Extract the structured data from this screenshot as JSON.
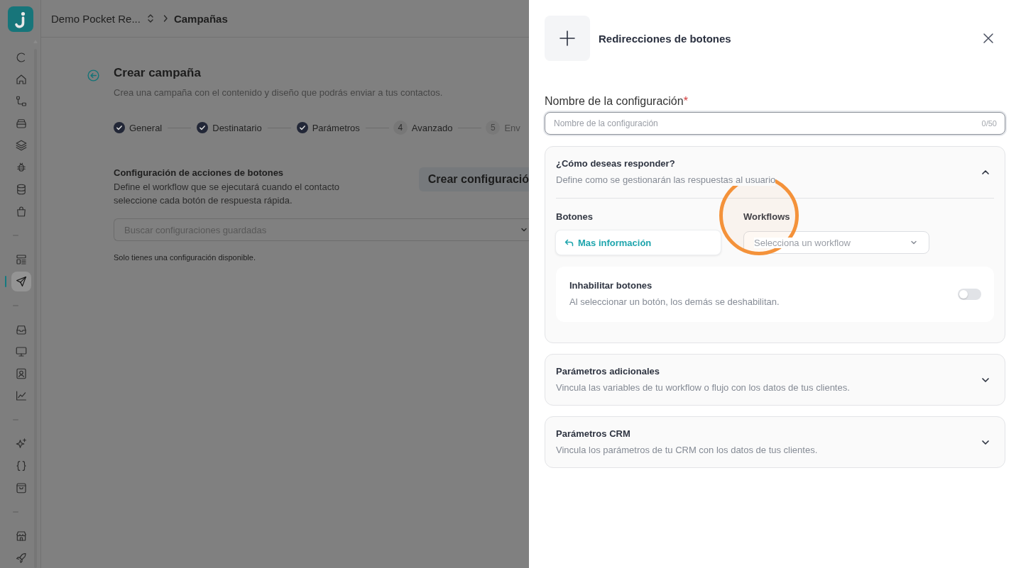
{
  "sidebar": {
    "groups": [
      {
        "items": [
          {
            "selected": false
          },
          {
            "selected": false
          },
          {
            "selected": false
          },
          {
            "selected": false
          },
          {
            "selected": false
          },
          {
            "selected": false
          },
          {
            "selected": false
          },
          {
            "selected": false
          }
        ]
      },
      {
        "items": [
          {
            "selected": false
          },
          {
            "selected": true
          }
        ]
      },
      {
        "items": [
          {
            "selected": false
          },
          {
            "selected": false
          },
          {
            "selected": false
          },
          {
            "selected": false
          }
        ]
      },
      {
        "items": [
          {
            "selected": false
          },
          {
            "selected": false
          },
          {
            "selected": false
          }
        ]
      },
      {
        "items": [
          {
            "selected": false
          },
          {
            "selected": false
          }
        ]
      }
    ]
  },
  "top_bar": {
    "workspace": "Demo Pocket Re...",
    "page": "Campañas"
  },
  "page": {
    "title": "Crear campaña",
    "subtitle": "Crea una campaña con el contenido y diseño que podrás enviar a tus contactos.",
    "steps": [
      {
        "label": "General",
        "completed": true,
        "disabled": false
      },
      {
        "label": "Destinatario",
        "completed": true,
        "disabled": false
      },
      {
        "label": "Parámetros",
        "completed": true,
        "disabled": false
      },
      {
        "number": "4",
        "label": "Avanzado",
        "completed": false,
        "disabled": false
      },
      {
        "number": "5",
        "label": "Env",
        "completed": false,
        "disabled": true
      }
    ],
    "section": {
      "title": "Configuración de acciones de botones",
      "description": "Define el workflow que se ejecutará cuando el contacto seleccione cada botón de respuesta rápida.",
      "create_button": "Crear configuració",
      "search": {
        "placeholder": "Buscar configuraciones guardadas"
      },
      "note": "Solo tienes una configuración disponible."
    }
  },
  "panel": {
    "title": "Redirecciones de botones",
    "field": {
      "label": "Nombre de la configuración",
      "required_mark": "*",
      "placeholder": "Nombre de la configuración",
      "counter": "0/50"
    },
    "sections": [
      {
        "title": "¿Cómo deseas responder?",
        "description": "Define como se gestionarán las respuestas al usuario",
        "expanded": true,
        "buttons_heading": "Botones",
        "workflows_heading": "Workflows",
        "annotation": {
          "kind": "ring"
        },
        "rows": [
          {
            "button": "Mas información",
            "workflow": {
              "placeholder": "Selecciona un workflow"
            }
          }
        ],
        "option": {
          "title": "Inhabilitar botones",
          "description": "Al seleccionar un botón, los demás se deshabilitan.",
          "on": false
        }
      },
      {
        "title": "Parámetros adicionales",
        "description": "Vincula las variables de tu workflow o flujo con los datos de tus clientes.",
        "expanded": false
      },
      {
        "title": "Parámetros CRM",
        "description": "Vincula los parámetros de tu CRM con los datos de tus clientes.",
        "expanded": false
      }
    ]
  }
}
